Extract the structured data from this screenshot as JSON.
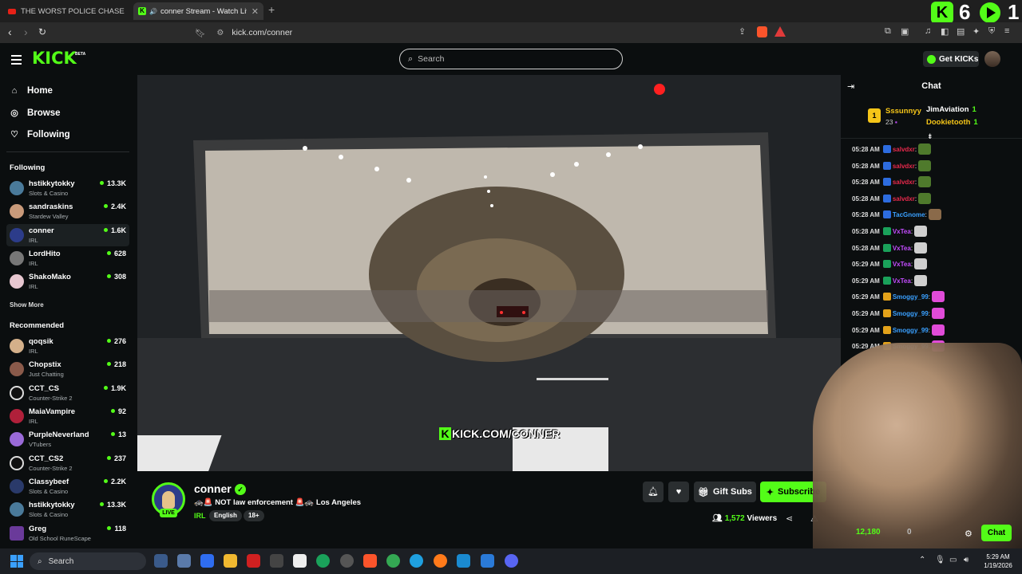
{
  "browser": {
    "tabs": [
      {
        "title": "THE WORST POLICE CHASE I'VE EVER"
      },
      {
        "title": "conner Stream - Watch Live o"
      }
    ],
    "url": "kick.com/conner"
  },
  "overlay": {
    "count1": "6",
    "count2": "1"
  },
  "header": {
    "logo": "KICK",
    "beta": "BETA",
    "search_placeholder": "Search",
    "get_kicks": "Get KICKs"
  },
  "sidebar": {
    "nav": [
      {
        "label": "Home",
        "icon": "home-icon"
      },
      {
        "label": "Browse",
        "icon": "compass-icon"
      },
      {
        "label": "Following",
        "icon": "heart-icon"
      }
    ],
    "following_title": "Following",
    "following": [
      {
        "name": "hstikkytokky",
        "game": "Slots & Casino",
        "viewers": "13.3K"
      },
      {
        "name": "sandraskins",
        "game": "Stardew Valley",
        "viewers": "2.4K"
      },
      {
        "name": "conner",
        "game": "IRL",
        "viewers": "1.6K"
      },
      {
        "name": "LordHito",
        "game": "IRL",
        "viewers": "628"
      },
      {
        "name": "ShakoMako",
        "game": "IRL",
        "viewers": "308"
      }
    ],
    "show_more": "Show More",
    "recommended_title": "Recommended",
    "recommended": [
      {
        "name": "qoqsik",
        "game": "IRL",
        "viewers": "276"
      },
      {
        "name": "Chopstix",
        "game": "Just Chatting",
        "viewers": "218"
      },
      {
        "name": "CCT_CS",
        "game": "Counter-Strike 2",
        "viewers": "1.9K"
      },
      {
        "name": "MaiaVampire",
        "game": "IRL",
        "viewers": "92"
      },
      {
        "name": "PurpleNeverland",
        "game": "VTubers",
        "viewers": "13"
      },
      {
        "name": "CCT_CS2",
        "game": "Counter-Strike 2",
        "viewers": "237"
      },
      {
        "name": "Classybeef",
        "game": "Slots & Casino",
        "viewers": "2.2K"
      },
      {
        "name": "hstikkytokky",
        "game": "Slots & Casino",
        "viewers": "13.3K"
      },
      {
        "name": "Greg",
        "game": "Old School RuneScape",
        "viewers": "118"
      }
    ]
  },
  "video": {
    "watermark": "KICK.COM/CONNER"
  },
  "stream": {
    "name": "conner",
    "live": "LIVE",
    "title": "🚓🚨 NOT law enforcement 🚨🚓 Los Angeles",
    "category": "IRL",
    "tags": [
      "English",
      "18+"
    ],
    "gift_label": "Gift Subs",
    "subscribe_label": "Subscribe",
    "viewers": "1,572",
    "viewers_label": "Viewers"
  },
  "chat": {
    "title": "Chat",
    "top_gifter": {
      "rank": "1",
      "name": "Sssunnyy",
      "count": "23"
    },
    "gifters": [
      {
        "name": "JimAviation",
        "count": "1",
        "color": "#ffffff"
      },
      {
        "name": "Dookietooth",
        "count": "1",
        "color": "#f5c518"
      }
    ],
    "messages": [
      {
        "time": "05:28 AM",
        "user": "salvdxr",
        "color": "#e8294c",
        "badge": "#2d6cdf",
        "emote": "#4f7a2c"
      },
      {
        "time": "05:28 AM",
        "user": "salvdxr",
        "color": "#e8294c",
        "badge": "#2d6cdf",
        "emote": "#4f7a2c"
      },
      {
        "time": "05:28 AM",
        "user": "salvdxr",
        "color": "#e8294c",
        "badge": "#2d6cdf",
        "emote": "#4f7a2c"
      },
      {
        "time": "05:28 AM",
        "user": "salvdxr",
        "color": "#e8294c",
        "badge": "#2d6cdf",
        "emote": "#4f7a2c"
      },
      {
        "time": "05:28 AM",
        "user": "TacGnome",
        "color": "#3aa0ff",
        "badge": "#2d6cdf",
        "emote": "#8a6a4a"
      },
      {
        "time": "05:28 AM",
        "user": "VxTea",
        "color": "#c44dff",
        "badge": "#1aa15a",
        "emote": "#cfcfcf"
      },
      {
        "time": "05:28 AM",
        "user": "VxTea",
        "color": "#c44dff",
        "badge": "#1aa15a",
        "emote": "#cfcfcf"
      },
      {
        "time": "05:29 AM",
        "user": "VxTea",
        "color": "#c44dff",
        "badge": "#1aa15a",
        "emote": "#cfcfcf"
      },
      {
        "time": "05:29 AM",
        "user": "VxTea",
        "color": "#c44dff",
        "badge": "#1aa15a",
        "emote": "#cfcfcf"
      },
      {
        "time": "05:29 AM",
        "user": "Smoggy_99",
        "color": "#3aa0ff",
        "badge": "#e3a21a",
        "emote": "#e04bd8"
      },
      {
        "time": "05:29 AM",
        "user": "Smoggy_99",
        "color": "#3aa0ff",
        "badge": "#e3a21a",
        "emote": "#e04bd8"
      },
      {
        "time": "05:29 AM",
        "user": "Smoggy_99",
        "color": "#3aa0ff",
        "badge": "#e3a21a",
        "emote": "#e04bd8"
      },
      {
        "time": "05:29 AM",
        "user": "Smoggy_99",
        "color": "#3aa0ff",
        "badge": "#e3a21a",
        "emote": "#e04bd8"
      }
    ],
    "kicks_balance": "12,180",
    "secondary_balance": "0",
    "send_label": "Chat"
  },
  "taskbar": {
    "search_label": "Search",
    "time": "5:29 AM",
    "date": "1/19/2026"
  },
  "colors": {
    "accent": "#53fc18",
    "background": "#0b0e0f"
  }
}
